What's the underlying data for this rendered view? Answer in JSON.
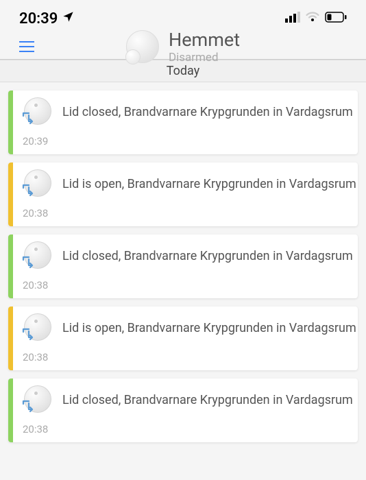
{
  "status_bar": {
    "time": "20:39"
  },
  "header": {
    "title": "Hemmet",
    "subtitle": "Disarmed"
  },
  "date_header": "Today",
  "colors": {
    "green": "#8dd35f",
    "yellow": "#f0c030"
  },
  "events": [
    {
      "stripe": "green",
      "message": "Lid closed, Brandvarnare Krypgrunden in Vardagsrum",
      "time": "20:39"
    },
    {
      "stripe": "yellow",
      "message": "Lid is open, Brandvarnare Krypgrunden in Vardagsrum",
      "time": "20:38"
    },
    {
      "stripe": "green",
      "message": "Lid closed, Brandvarnare Krypgrunden in Vardagsrum",
      "time": "20:38"
    },
    {
      "stripe": "yellow",
      "message": "Lid is open, Brandvarnare Krypgrunden in Vardagsrum",
      "time": "20:38"
    },
    {
      "stripe": "green",
      "message": "Lid closed, Brandvarnare Krypgrunden in Vardagsrum",
      "time": "20:38"
    }
  ]
}
